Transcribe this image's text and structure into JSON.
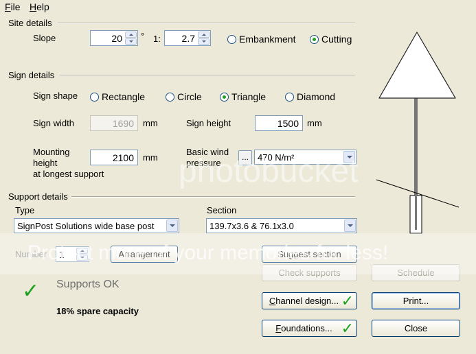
{
  "menu": {
    "file": "File",
    "file_key": "F",
    "file_rest": "ile",
    "help_key": "H",
    "help_rest": "elp"
  },
  "site": {
    "title": "Site details",
    "slope_label": "Slope",
    "slope_value": "20",
    "degree_symbol": "°",
    "ratio_label": "1:",
    "ratio_value": "2.7",
    "options": [
      {
        "label": "Embankment",
        "selected": false
      },
      {
        "label": "Cutting",
        "selected": true
      }
    ]
  },
  "sign": {
    "title": "Sign details",
    "shape_label": "Sign shape",
    "shapes": [
      {
        "label": "Rectangle",
        "selected": false
      },
      {
        "label": "Circle",
        "selected": false
      },
      {
        "label": "Triangle",
        "selected": true
      },
      {
        "label": "Diamond",
        "selected": false
      }
    ],
    "width_label": "Sign width",
    "width_value": "1690",
    "width_unit": "mm",
    "height_label": "Sign height",
    "height_value": "1500",
    "height_unit": "mm",
    "mount_label_1": "Mounting",
    "mount_label_2": "height",
    "mount_label_3": "at longest support",
    "mount_value": "2100",
    "mount_unit": "mm",
    "wind_label_1": "Basic wind",
    "wind_label_2": "pressure",
    "wind_btn": "...",
    "wind_value": "470 N/m²"
  },
  "support": {
    "title": "Support details",
    "type_label": "Type",
    "type_value": "SignPost Solutions wide base post",
    "section_label": "Section",
    "section_value": "139.7x3.6 & 76.1x3.0",
    "number_label": "Number",
    "number_value": "1",
    "arrangement_btn": "Arrangement",
    "suggest_btn": "Suggest section"
  },
  "status": {
    "title": "Supports OK",
    "capacity": "18% spare capacity",
    "check_color": "#20a020"
  },
  "buttons": {
    "check_supports": "Check supports",
    "schedule": "Schedule",
    "channel_design": "Channel design...",
    "channel_key": "C",
    "channel_rest": "hannel design...",
    "print": "Print...",
    "foundations_key": "F",
    "foundations_rest": "oundations...",
    "close": "Close"
  },
  "watermark": {
    "logo": "photobucket",
    "tagline": "Protect more of your memories for less!"
  }
}
